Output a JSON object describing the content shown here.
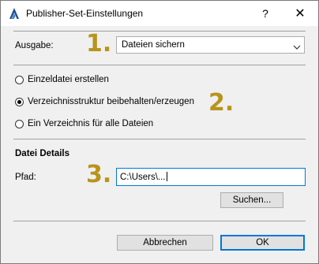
{
  "window": {
    "title": "Publisher-Set-Einstellungen",
    "help_label": "?",
    "close_label": "✕"
  },
  "ausgabe": {
    "label": "Ausgabe:",
    "value": "Dateien sichern"
  },
  "radios": [
    {
      "label": "Einzeldatei erstellen",
      "checked": false
    },
    {
      "label": "Verzeichnisstruktur beibehalten/erzeugen",
      "checked": true
    },
    {
      "label": "Ein Verzeichnis für alle Dateien",
      "checked": false
    }
  ],
  "details": {
    "header": "Datei Details",
    "path_label": "Pfad:",
    "path_value": "C:\\Users\\...",
    "browse_label": "Suchen..."
  },
  "footer": {
    "cancel_label": "Abbrechen",
    "ok_label": "OK"
  },
  "markers": [
    "1.",
    "2.",
    "3."
  ],
  "colors": {
    "marker": "#b8941c",
    "accent": "#0078d7"
  }
}
